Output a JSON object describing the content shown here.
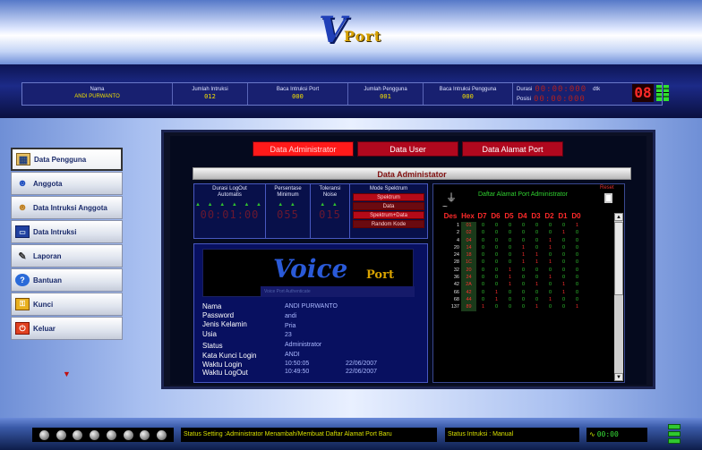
{
  "logo": {
    "letter": "V",
    "word": "Port"
  },
  "infobar": {
    "nama_label": "Nama",
    "nama_value": "ANDI PURWANTO",
    "jumlah_intruksi_label": "Jumlah Intruksi",
    "jumlah_intruksi_value": "012",
    "baca_intruksi_port_label": "Baca Intruksi Port",
    "baca_intruksi_port_value": "000",
    "jumlah_pengguna_label": "Jumlah Pengguna",
    "jumlah_pengguna_value": "001",
    "baca_intruksi_pengguna_label": "Baca Intruksi Pengguna",
    "baca_intruksi_pengguna_value": "000",
    "durasi_label": "Durasi",
    "durasi_value": "00:00:000",
    "posisi_label": "Posisi",
    "posisi_value": "00:00:000",
    "unit": "dtk",
    "big_display": "08"
  },
  "sidebar": {
    "items": [
      {
        "label": "Data Pengguna",
        "icon": "users-table-icon"
      },
      {
        "label": "Anggota",
        "icon": "members-icon"
      },
      {
        "label": "Data Intruksi Anggota",
        "icon": "member-instruction-icon"
      },
      {
        "label": "Data Intruksi",
        "icon": "monitor-icon"
      },
      {
        "label": "Laporan",
        "icon": "report-pen-icon"
      },
      {
        "label": "Bantuan",
        "icon": "help-icon"
      },
      {
        "label": "Kunci",
        "icon": "lock-icon"
      },
      {
        "label": "Keluar",
        "icon": "power-icon"
      }
    ],
    "arrow": "▼"
  },
  "tabs": [
    "Data Administrator",
    "Data User",
    "Data Alamat Port"
  ],
  "panel_title": "Data Administator",
  "controls": {
    "durasi_label": "Durasi LogOut Automatis",
    "durasi_value": "00:01:00",
    "persentase_label": "Persentase Minimum",
    "persentase_value": "055",
    "toleransi_label": "Toleransi Noise",
    "toleransi_value": "015",
    "mode_label": "Mode Spektrum",
    "mode_buttons": [
      "Spektrum",
      "Data",
      "Spektrum+Data",
      "Random Kode"
    ]
  },
  "voiceport": {
    "word1": "Voice",
    "word2": "Port",
    "tagline": "Voice Port Authenticate"
  },
  "info": {
    "nama_label": "Nama",
    "nama_value": "ANDI PURWANTO",
    "password_label": "Password",
    "password_value": "andi",
    "jk_label": "Jenis Kelamin",
    "jk_value": "Pria",
    "usia_label": "Usia",
    "usia_value": "23",
    "status_label": "Status",
    "status_value": "Administrator",
    "kunci_label": "Kata Kunci Login",
    "kunci_value": "ANDI",
    "login_label": "Waktu Login",
    "login_time": "10:50:05",
    "login_date": "22/06/2007",
    "logout_label": "Waktu LogOut",
    "logout_time": "10:49:50",
    "logout_date": "22/06/2007"
  },
  "port": {
    "title": "Daftar Alamat Port Administrator",
    "reset": "Reset",
    "headers": [
      "Des",
      "Hex",
      "D7",
      "D6",
      "D5",
      "D4",
      "D3",
      "D2",
      "D1",
      "D0"
    ],
    "rows": [
      [
        "1",
        "01",
        "0",
        "0",
        "0",
        "0",
        "0",
        "0",
        "0",
        "1"
      ],
      [
        "2",
        "02",
        "0",
        "0",
        "0",
        "0",
        "0",
        "0",
        "1",
        "0"
      ],
      [
        "4",
        "04",
        "0",
        "0",
        "0",
        "0",
        "0",
        "1",
        "0",
        "0"
      ],
      [
        "20",
        "14",
        "0",
        "0",
        "0",
        "1",
        "0",
        "1",
        "0",
        "0"
      ],
      [
        "24",
        "18",
        "0",
        "0",
        "0",
        "1",
        "1",
        "0",
        "0",
        "0"
      ],
      [
        "28",
        "1C",
        "0",
        "0",
        "0",
        "1",
        "1",
        "1",
        "0",
        "0"
      ],
      [
        "32",
        "20",
        "0",
        "0",
        "1",
        "0",
        "0",
        "0",
        "0",
        "0"
      ],
      [
        "36",
        "24",
        "0",
        "0",
        "1",
        "0",
        "0",
        "1",
        "0",
        "0"
      ],
      [
        "42",
        "2A",
        "0",
        "0",
        "1",
        "0",
        "1",
        "0",
        "1",
        "0"
      ],
      [
        "66",
        "42",
        "0",
        "1",
        "0",
        "0",
        "0",
        "0",
        "1",
        "0"
      ],
      [
        "68",
        "44",
        "0",
        "1",
        "0",
        "0",
        "0",
        "1",
        "0",
        "0"
      ],
      [
        "137",
        "89",
        "1",
        "0",
        "0",
        "0",
        "1",
        "0",
        "0",
        "1"
      ]
    ]
  },
  "bottom": {
    "status_setting": "Status Setting :Administrator Menambah/Membuat Daftar Alamat Port Baru",
    "status_intruksi": "Status Intruksi :  Manual",
    "clock": "00:00"
  }
}
